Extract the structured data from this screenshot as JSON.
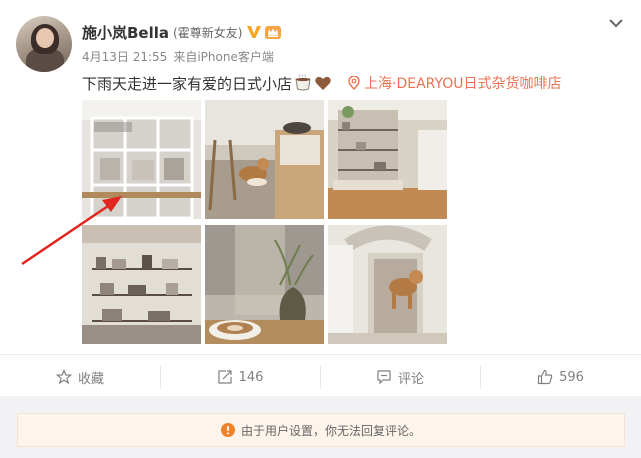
{
  "post": {
    "author": {
      "name": "施小岚Bella",
      "tagline": "(霍尊新女友)"
    },
    "meta": {
      "date": "4月13日 21:55",
      "source_prefix": "来自",
      "source": "iPhone客户端"
    },
    "text": "下雨天走进一家有爱的日式小店",
    "location": "上海·DEARYOU日式杂货咖啡店",
    "images": [
      {
        "icon": "shop-window-image"
      },
      {
        "icon": "dog-in-shop-image"
      },
      {
        "icon": "shelves-image"
      },
      {
        "icon": "ceramics-shelf-image"
      },
      {
        "icon": "coffee-plant-image"
      },
      {
        "icon": "dog-doorway-image"
      }
    ]
  },
  "actions": {
    "favorite_label": "收藏",
    "repost_count": "146",
    "comment_label": "评论",
    "like_count": "596"
  },
  "notice": {
    "text": "由于用户设置，你无法回复评论。"
  },
  "colors": {
    "accent": "#eb7350",
    "vip": "#f5a623",
    "arrow": "#e0261f",
    "notice_icon": "#f0822a",
    "notice_bg": "#fdf4ec"
  }
}
